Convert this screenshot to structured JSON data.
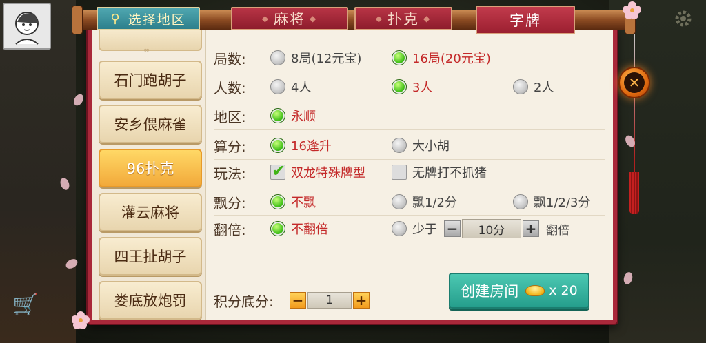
{
  "tabs": {
    "area": "选择地区",
    "mahjong": "麻将",
    "poker": "扑克",
    "zipai": "字牌"
  },
  "sidebar": {
    "items": [
      {
        "label": "石门跑胡子",
        "active": false
      },
      {
        "label": "安乡偎麻雀",
        "active": false
      },
      {
        "label": "96扑克",
        "active": true
      },
      {
        "label": "灌云麻将",
        "active": false
      },
      {
        "label": "四王扯胡子",
        "active": false
      },
      {
        "label": "娄底放炮罚",
        "active": false
      }
    ]
  },
  "options": {
    "rounds": {
      "label": "局数:",
      "opt1": "8局(12元宝)",
      "opt2": "16局(20元宝)"
    },
    "players": {
      "label": "人数:",
      "opt1": "4人",
      "opt2": "3人",
      "opt3": "2人"
    },
    "region": {
      "label": "地区:",
      "opt1": "永顺"
    },
    "scoring": {
      "label": "算分:",
      "opt1": "16逢升",
      "opt2": "大小胡"
    },
    "play": {
      "label": "玩法:",
      "opt1": "双龙特殊牌型",
      "opt2": "无牌打不抓猪"
    },
    "float": {
      "label": "飘分:",
      "opt1": "不飘",
      "opt2": "飘1/2分",
      "opt3": "飘1/2/3分"
    },
    "double": {
      "label": "翻倍:",
      "opt1": "不翻倍",
      "opt2": "少于",
      "stepper_value": "10分",
      "suffix": "翻倍"
    },
    "base_score": {
      "label": "积分底分:",
      "value": "1"
    }
  },
  "create": {
    "label": "创建房间",
    "cost": "x 20"
  },
  "icons": {
    "minus": "−",
    "plus": "+",
    "close": "✕",
    "pin": "⚲"
  }
}
